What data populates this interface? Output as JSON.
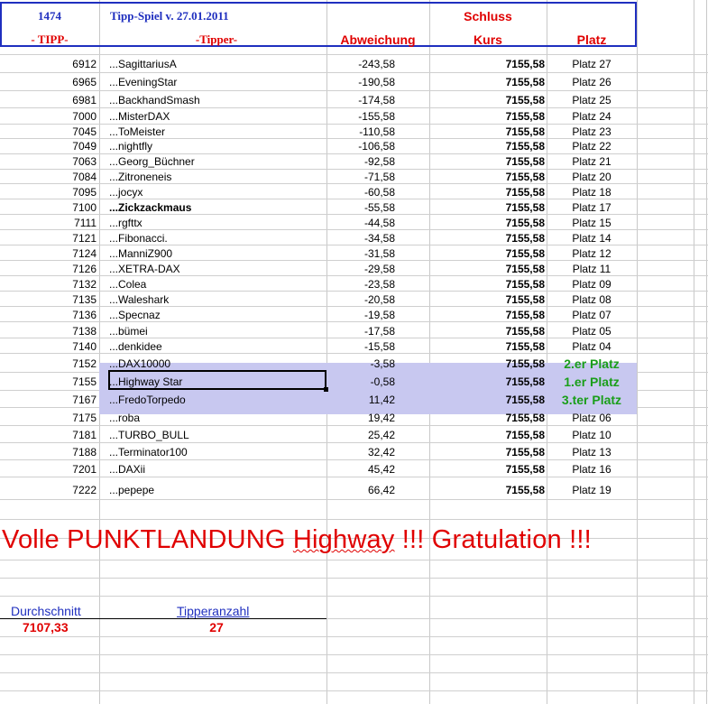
{
  "header": {
    "number": "1474",
    "title": "Tipp-Spiel v. 27.01.2011",
    "schluss": "Schluss",
    "col_tipp": "- TIPP-",
    "col_tipper": "-Tipper-",
    "col_abweichung": "Abweichung",
    "col_kurs": "Kurs",
    "col_platz": "Platz"
  },
  "rows": [
    {
      "tipp": "6912",
      "name": "...SagittariusA",
      "abw": "-243,58",
      "kurs": "7155,58",
      "platz": "Platz 27"
    },
    {
      "tipp": "6965",
      "name": "...EveningStar",
      "abw": "-190,58",
      "kurs": "7155,58",
      "platz": "Platz 26"
    },
    {
      "tipp": "6981",
      "name": "...BackhandSmash",
      "abw": "-174,58",
      "kurs": "7155,58",
      "platz": "Platz 25"
    },
    {
      "tipp": "7000",
      "name": "...MisterDAX",
      "abw": "-155,58",
      "kurs": "7155,58",
      "platz": "Platz 24"
    },
    {
      "tipp": "7045",
      "name": "...ToMeister",
      "abw": "-110,58",
      "kurs": "7155,58",
      "platz": "Platz 23"
    },
    {
      "tipp": "7049",
      "name": "...nightfly",
      "abw": "-106,58",
      "kurs": "7155,58",
      "platz": "Platz 22"
    },
    {
      "tipp": "7063",
      "name": "...Georg_Büchner",
      "abw": "-92,58",
      "kurs": "7155,58",
      "platz": "Platz 21"
    },
    {
      "tipp": "7084",
      "name": "...Zitroneneis",
      "abw": "-71,58",
      "kurs": "7155,58",
      "platz": "Platz 20"
    },
    {
      "tipp": "7095",
      "name": "...jocyx",
      "abw": "-60,58",
      "kurs": "7155,58",
      "platz": "Platz 18"
    },
    {
      "tipp": "7100",
      "name": "...Zickzackmaus",
      "abw": "-55,58",
      "kurs": "7155,58",
      "platz": "Platz 17"
    },
    {
      "tipp": "7111",
      "name": "...rgfttx",
      "abw": "-44,58",
      "kurs": "7155,58",
      "platz": "Platz 15"
    },
    {
      "tipp": "7121",
      "name": "...Fibonacci.",
      "abw": "-34,58",
      "kurs": "7155,58",
      "platz": "Platz 14"
    },
    {
      "tipp": "7124",
      "name": "...ManniZ900",
      "abw": "-31,58",
      "kurs": "7155,58",
      "platz": "Platz 12"
    },
    {
      "tipp": "7126",
      "name": "...XETRA-DAX",
      "abw": "-29,58",
      "kurs": "7155,58",
      "platz": "Platz 11"
    },
    {
      "tipp": "7132",
      "name": "...Colea",
      "abw": "-23,58",
      "kurs": "7155,58",
      "platz": "Platz 09"
    },
    {
      "tipp": "7135",
      "name": "...Waleshark",
      "abw": "-20,58",
      "kurs": "7155,58",
      "platz": "Platz 08"
    },
    {
      "tipp": "7136",
      "name": "...Specnaz",
      "abw": "-19,58",
      "kurs": "7155,58",
      "platz": "Platz 07"
    },
    {
      "tipp": "7138",
      "name": "...bümei",
      "abw": "-17,58",
      "kurs": "7155,58",
      "platz": "Platz 05"
    },
    {
      "tipp": "7140",
      "name": "...denkidee",
      "abw": "-15,58",
      "kurs": "7155,58",
      "platz": "Platz 04"
    },
    {
      "tipp": "7152",
      "name": "...DAX10000",
      "abw": "-3,58",
      "kurs": "7155,58",
      "platz": "2.er Platz"
    },
    {
      "tipp": "7155",
      "name": "...Highway Star",
      "abw": "-0,58",
      "kurs": "7155,58",
      "platz": "1.er Platz"
    },
    {
      "tipp": "7167",
      "name": "...FredoTorpedo",
      "abw": "11,42",
      "kurs": "7155,58",
      "platz": "3.ter Platz"
    },
    {
      "tipp": "7175",
      "name": "...roba",
      "abw": "19,42",
      "kurs": "7155,58",
      "platz": "Platz 06"
    },
    {
      "tipp": "7181",
      "name": "...TURBO_BULL",
      "abw": "25,42",
      "kurs": "7155,58",
      "platz": "Platz 10"
    },
    {
      "tipp": "7188",
      "name": "...Terminator100",
      "abw": "32,42",
      "kurs": "7155,58",
      "platz": "Platz 13"
    },
    {
      "tipp": "7201",
      "name": "...DAXii",
      "abw": "45,42",
      "kurs": "7155,58",
      "platz": "Platz 16"
    },
    {
      "tipp": "7222",
      "name": "...pepepe",
      "abw": "66,42",
      "kurs": "7155,58",
      "platz": "Platz 19"
    }
  ],
  "banner": {
    "part1": "Volle PUNKTLANDUNG ",
    "word": "Highway",
    "part2": " !!! Gratulation !!!"
  },
  "summary": {
    "avg_label": "Durchschnitt",
    "avg_value": "7107,33",
    "count_label": "Tipperanzahl",
    "count_value": "27"
  },
  "colors": {
    "header_blue": "#1f2fbf",
    "red": "#e00000",
    "green": "#1a9e1a",
    "highlight": "#c8c8f0"
  }
}
